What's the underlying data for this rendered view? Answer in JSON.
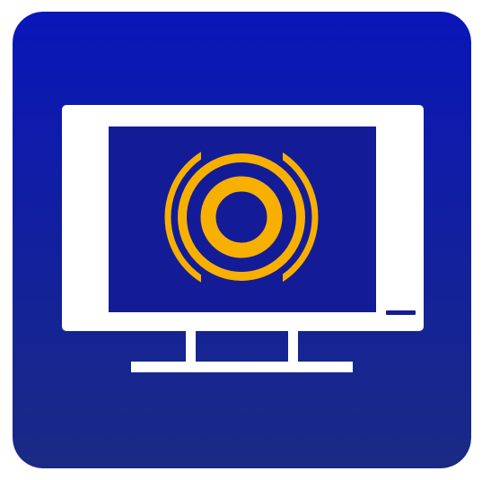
{
  "app_icon": {
    "icon_name": "monitor-with-signal-icon",
    "colors": {
      "tile_top": "#0a16b8",
      "tile_bottom": "#1a2a84",
      "screen_fill": "#131c96",
      "monitor_frame": "#ffffff",
      "signal_rings": "#f8b000",
      "power_indicator": "#161d8e"
    }
  }
}
